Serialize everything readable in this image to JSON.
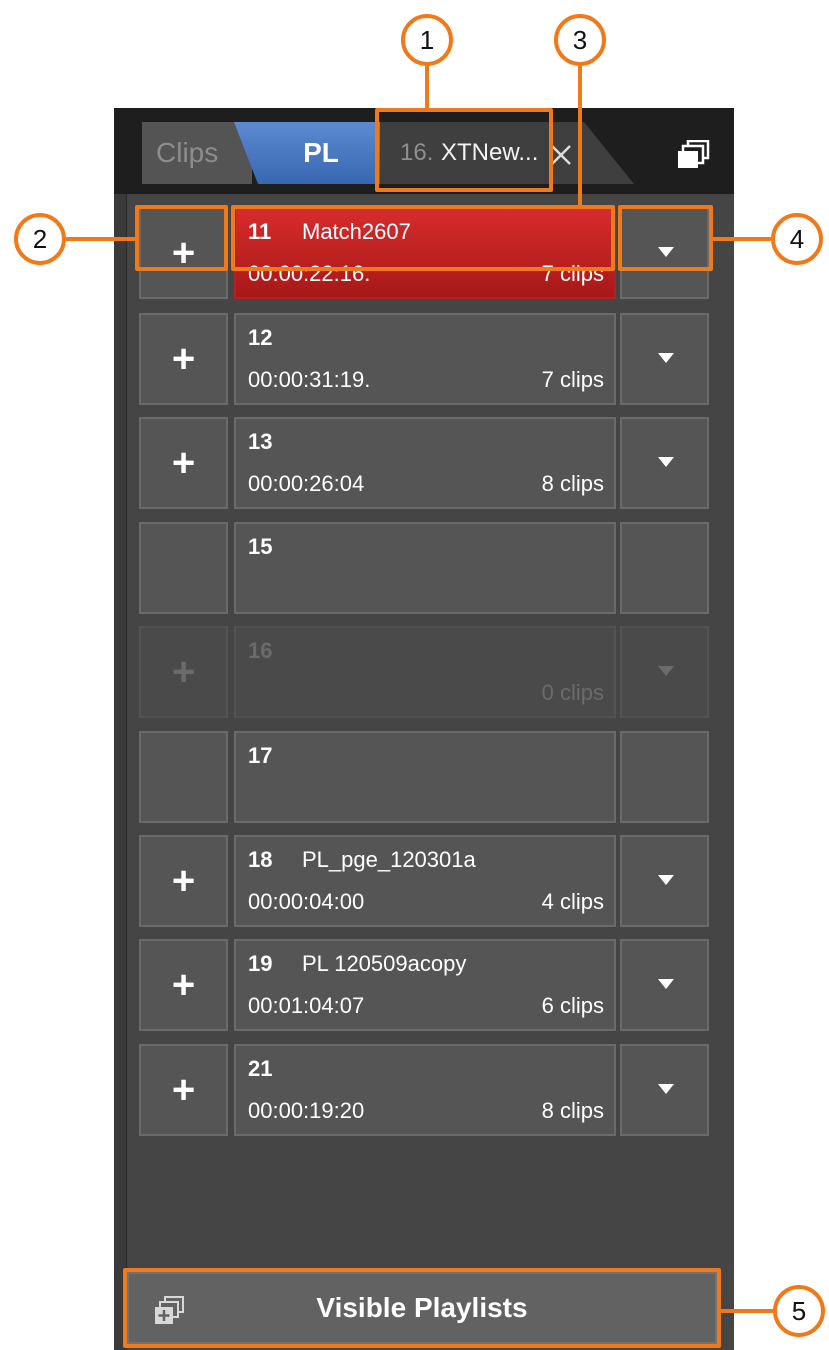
{
  "tabs": {
    "clips_label": "Clips",
    "pl_label": "PL",
    "open_tab_number": "16.",
    "open_tab_name": "XTNew..."
  },
  "icons": {
    "close": "close-icon",
    "stack": "stack-icon",
    "add": "plus-icon",
    "dropdown": "dropdown-icon"
  },
  "playlists": [
    {
      "number": "11",
      "name": "Match2607",
      "duration": "00:00:22:16.",
      "clips": "7 clips",
      "selected": true,
      "plus": "+"
    },
    {
      "number": "12",
      "name": "",
      "duration": "00:00:31:19.",
      "clips": "7 clips",
      "plus": "+"
    },
    {
      "number": "13",
      "name": "",
      "duration": "00:00:26:04",
      "clips": "8 clips",
      "plus": "+"
    },
    {
      "number": "15",
      "name": "",
      "duration": "",
      "clips": "",
      "plus": ""
    },
    {
      "number": "16",
      "name": "",
      "duration": "",
      "clips": "0 clips",
      "disabled": true,
      "plus": "+"
    },
    {
      "number": "17",
      "name": "",
      "duration": "",
      "clips": "",
      "plus": ""
    },
    {
      "number": "18",
      "name": "PL_pge_120301a",
      "duration": "00:00:04:00",
      "clips": "4 clips",
      "plus": "+"
    },
    {
      "number": "19",
      "name": "PL 120509acopy",
      "duration": "00:01:04:07",
      "clips": "6 clips",
      "plus": "+"
    },
    {
      "number": "21",
      "name": "",
      "duration": "00:00:19:20",
      "clips": "8 clips",
      "plus": "+"
    }
  ],
  "footer": {
    "visible_playlists_label": "Visible Playlists"
  },
  "callouts": [
    "1",
    "2",
    "3",
    "4",
    "5"
  ],
  "colors": {
    "accent_orange": "#f07a1a",
    "selected_red": "#c02020",
    "pl_tab_blue": "#4a78c2",
    "cell_gray": "#555555"
  }
}
